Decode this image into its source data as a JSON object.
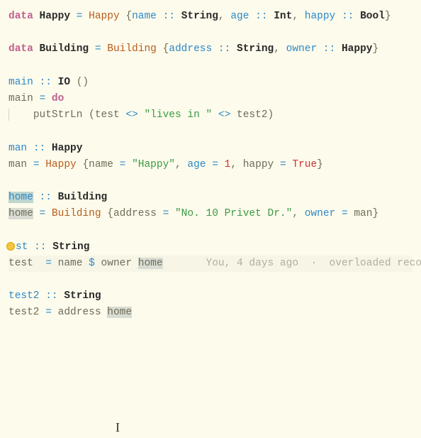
{
  "t": {
    "data": "data",
    "Happy": "Happy",
    "Building": "Building",
    "name": "name",
    "String": "String",
    "age": "age",
    "Int": "Int",
    "happy": "happy",
    "Bool": "Bool",
    "address": "address",
    "owner": "owner",
    "main": "main",
    "IO": "IO",
    "unit": "()",
    "do": "do",
    "putStrLn": "putStrLn",
    "test": "test",
    "test2": "test2",
    "man": "man",
    "home": "home",
    "livesIn": "\"lives in \"",
    "happyStr": "\"Happy\"",
    "one": "1",
    "True": "True",
    "privet": "\"No. 10 Privet Dr.\"",
    "dcolon": "::",
    "eq": "=",
    "lbrace": "{",
    "rbrace": "}",
    "comma": ",",
    "lparen": "(",
    "rparen": ")",
    "diamond": "<>",
    "dollar": "$"
  },
  "blame": {
    "who": "You, 4 days ago",
    "sep": "·",
    "msg": "overloaded record "
  }
}
